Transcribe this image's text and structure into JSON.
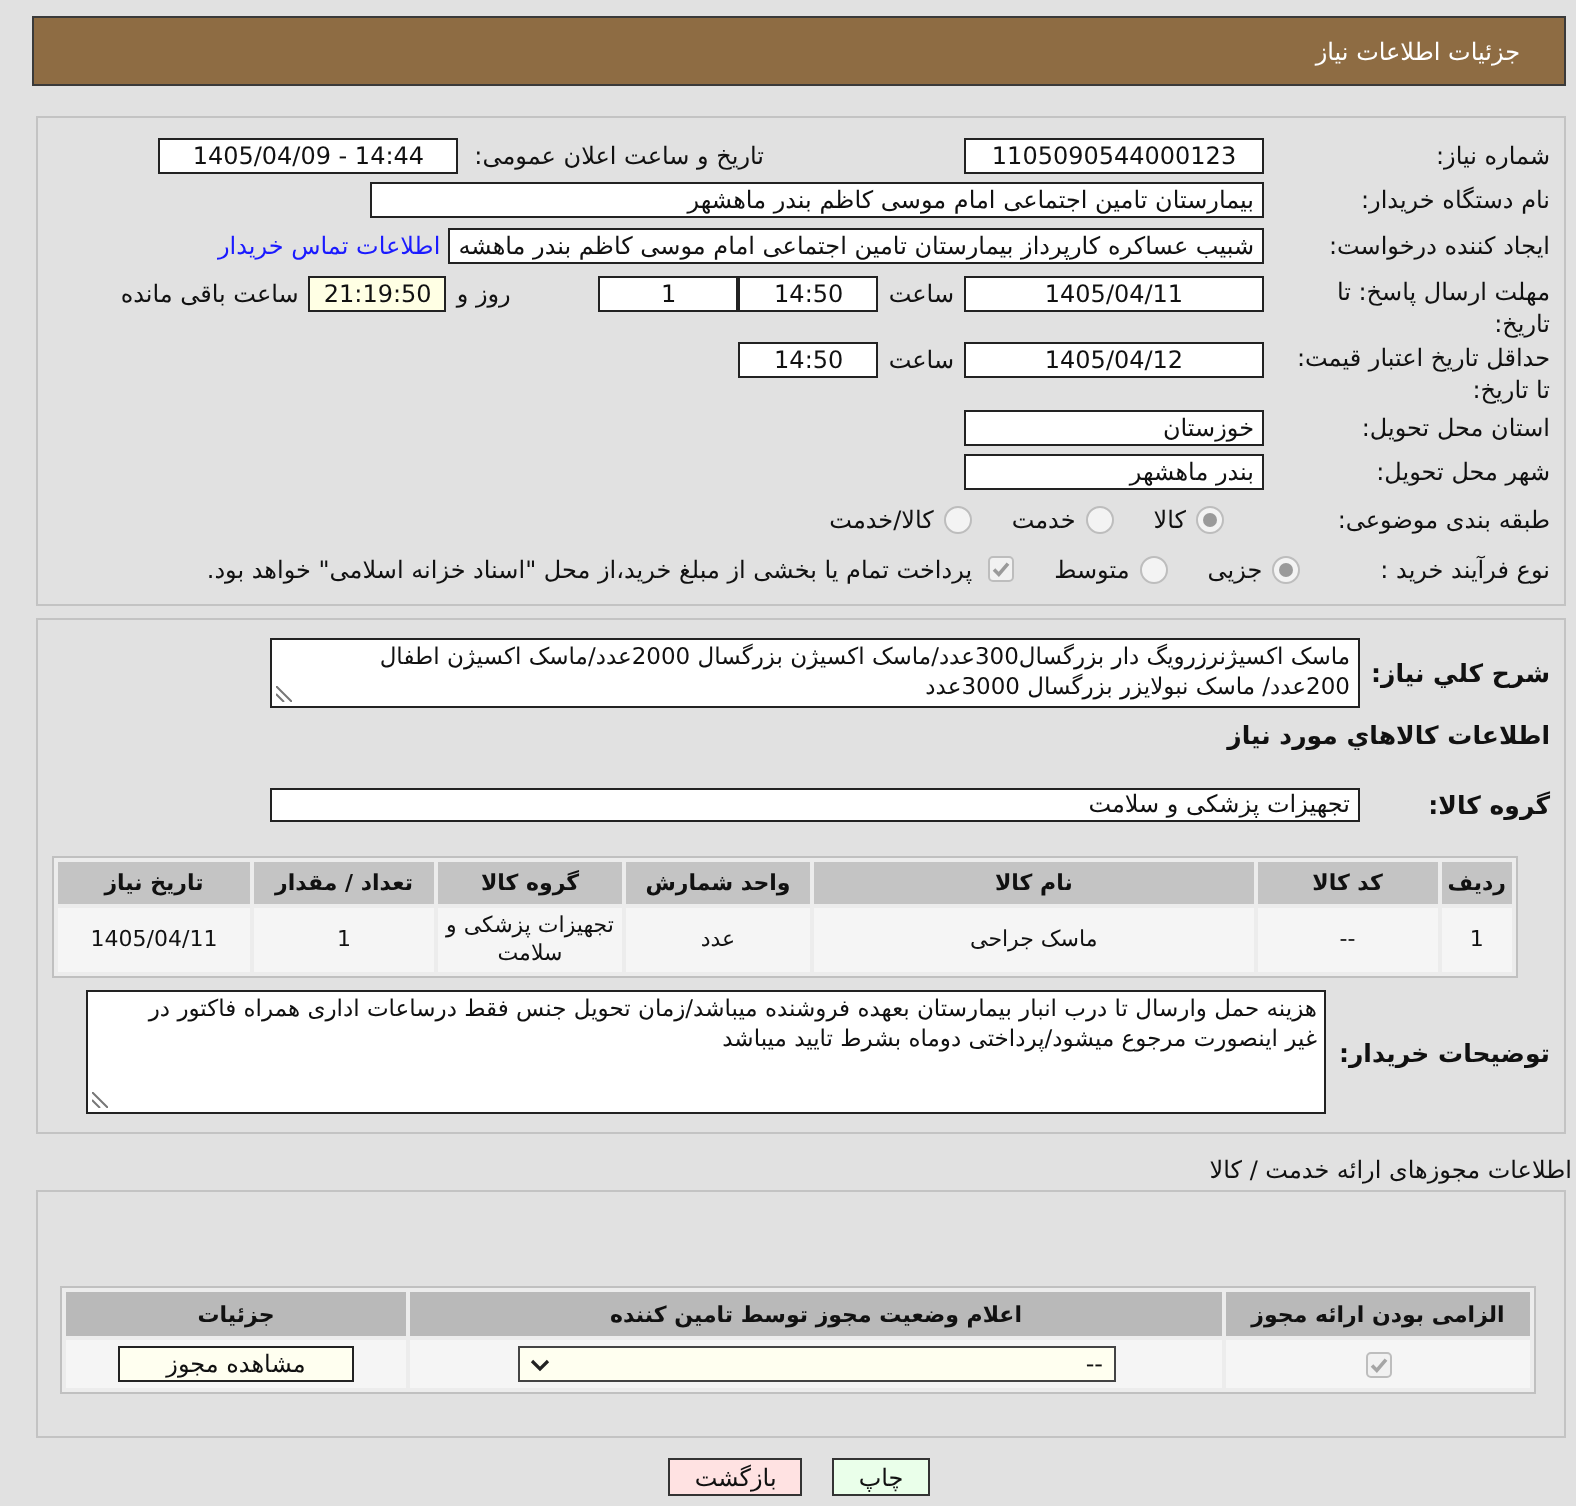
{
  "header": {
    "title": "جزئیات اطلاعات نیاز"
  },
  "need_info": {
    "need_number": {
      "label": "شماره نیاز:",
      "value": "1105090544000123"
    },
    "announcement": {
      "label": "تاریخ و ساعت اعلان عمومی:",
      "value": "1405/04/09 - 14:44"
    },
    "buyer_org": {
      "label": "نام دستگاه خریدار:",
      "value": "بیمارستان تامین اجتماعی امام موسی کاظم بندر ماهشهر"
    },
    "requester": {
      "label": "ایجاد کننده درخواست:",
      "value": "شبیب عساکره کارپرداز بیمارستان تامین اجتماعی امام موسی کاظم بندر ماهشه",
      "contact_link": "اطلاعات تماس خریدار"
    },
    "response_deadline": {
      "label": "مهلت ارسال پاسخ: تا تاریخ:",
      "date": "1405/04/11",
      "time_label": "ساعت",
      "time": "14:50",
      "days": "1",
      "days_label": "روز و",
      "remaining": "21:19:50",
      "remaining_label": "ساعت باقی مانده"
    },
    "price_validity": {
      "label": "حداقل تاریخ اعتبار قیمت: تا تاریخ:",
      "date": "1405/04/12",
      "time_label": "ساعت",
      "time": "14:50"
    },
    "delivery_province": {
      "label": "استان محل تحویل:",
      "value": "خوزستان"
    },
    "delivery_city": {
      "label": "شهر محل تحویل:",
      "value": "بندر ماهشهر"
    },
    "category": {
      "label": "طبقه بندی موضوعی:",
      "options": [
        {
          "label": "کالا",
          "selected": true
        },
        {
          "label": "خدمت",
          "selected": false
        },
        {
          "label": "کالا/خدمت",
          "selected": false
        }
      ]
    },
    "purchase_process": {
      "label": "نوع فرآیند خرید :",
      "options": [
        {
          "label": "جزیی",
          "selected": true
        },
        {
          "label": "متوسط",
          "selected": false
        }
      ],
      "treasury_payment": {
        "label": "پرداخت تمام یا بخشی از مبلغ خرید،از محل \"اسناد خزانه اسلامی\" خواهد بود.",
        "checked": true
      }
    }
  },
  "need_details": {
    "description": {
      "label": "شرح کلي نياز:",
      "value": "ماسک اکسیژنرزرویگ دار بزرگسال300عدد/ماسک اکسیژن بزرگسال 2000عدد/ماسک اکسیژن اطفال 200عدد/ ماسک نبولایزر بزرگسال 3000عدد"
    },
    "goods_title": "اطلاعات کالاهاي مورد نياز",
    "goods_group": {
      "label": "گروه کالا:",
      "value": "تجهیزات پزشکی و سلامت"
    },
    "items_table": {
      "columns": [
        "ردیف",
        "کد کالا",
        "نام کالا",
        "واحد شمارش",
        "گروه کالا",
        "تعداد / مقدار",
        "تاریخ نیاز"
      ],
      "rows": [
        [
          "1",
          "--",
          "ماسک جراحی",
          "عدد",
          "تجهیزات پزشکی و سلامت",
          "1",
          "1405/04/11"
        ]
      ]
    },
    "buyer_notes": {
      "label": "توضیحات خریدار:",
      "value": "هزینه حمل وارسال تا درب انبار بیمارستان بعهده فروشنده میباشد/زمان تحویل جنس فقط درساعات اداری همراه فاکتور در غیر اینصورت مرجوع میشود/پرداختی دوماه بشرط تایید میباشد"
    }
  },
  "permits": {
    "title": "اطلاعات مجوزهای ارائه خدمت / کالا",
    "columns": [
      "الزامی بودن ارائه مجوز",
      "اعلام وضعیت مجوز توسط تامین کننده",
      "جزئیات"
    ],
    "rows": [
      {
        "required": true,
        "status": "--",
        "details_button": "مشاهده مجوز"
      }
    ]
  },
  "actions": [
    {
      "label": "چاپ",
      "kind": "print"
    },
    {
      "label": "بازگشت",
      "kind": "back"
    }
  ]
}
